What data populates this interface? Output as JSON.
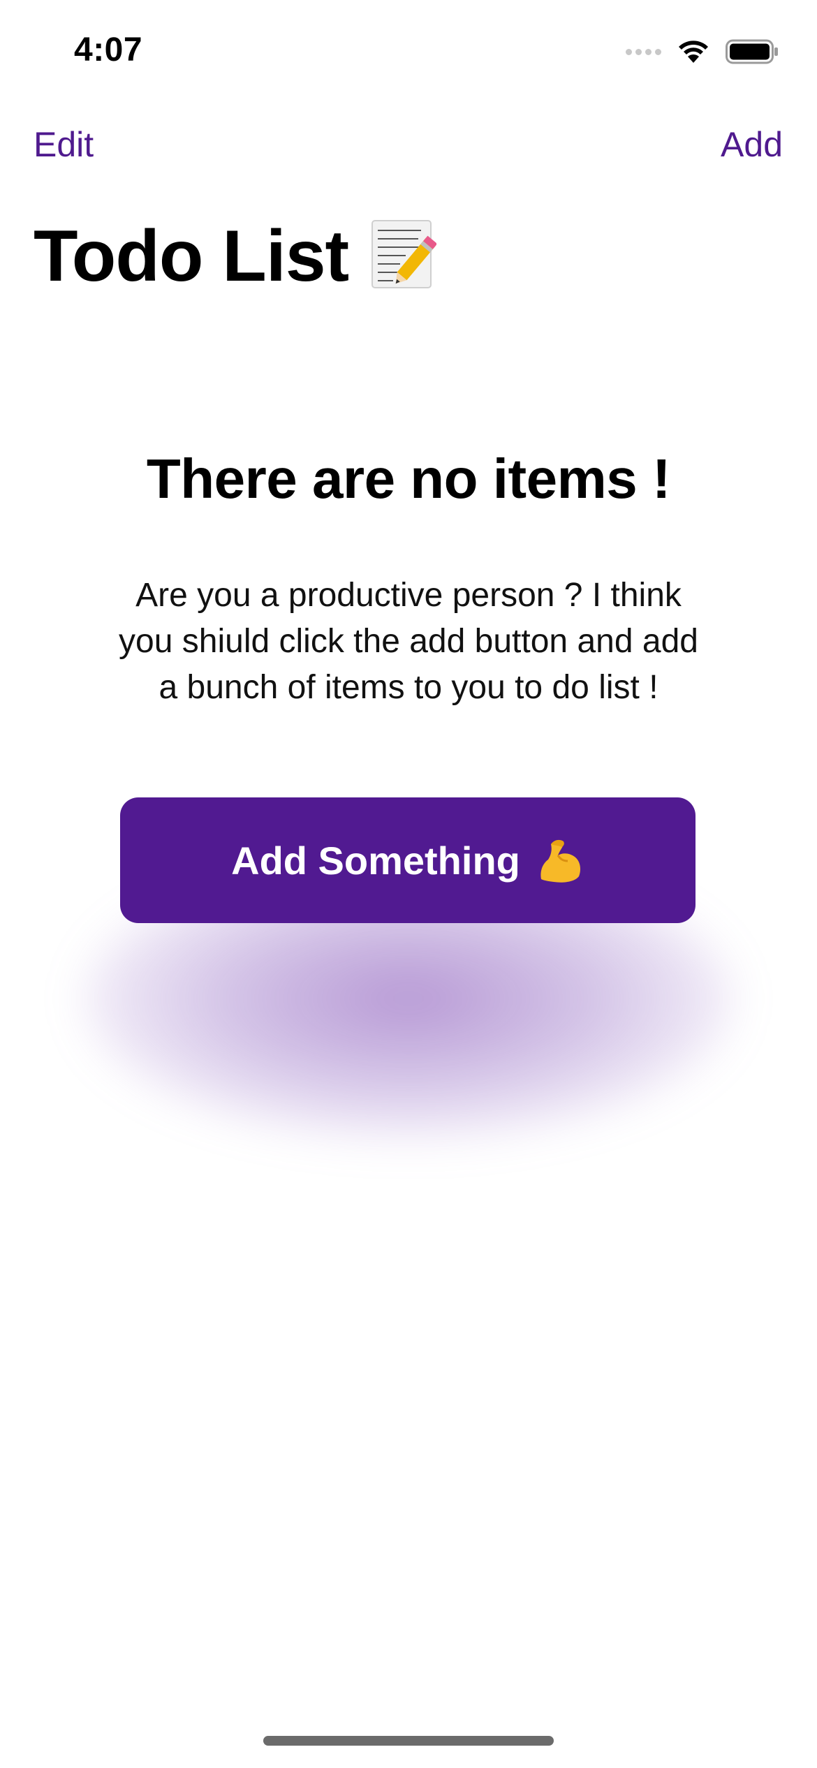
{
  "status_bar": {
    "time": "4:07",
    "icons": [
      "cellular-signal-icon",
      "wifi-icon",
      "battery-icon"
    ]
  },
  "nav": {
    "left_label": "Edit",
    "right_label": "Add"
  },
  "title": {
    "text": "Todo List",
    "icon": "memo-icon"
  },
  "empty_state": {
    "heading": "There are no items !",
    "message": "Are you a productive person ? I think you shiuld click the add button and add a bunch of items to you to do list !",
    "button_label": "Add Something",
    "button_icon": "flexed-biceps-icon"
  },
  "colors": {
    "accent": "#4f1a8e",
    "button_bg": "#511a91",
    "button_text": "#ffffff"
  }
}
